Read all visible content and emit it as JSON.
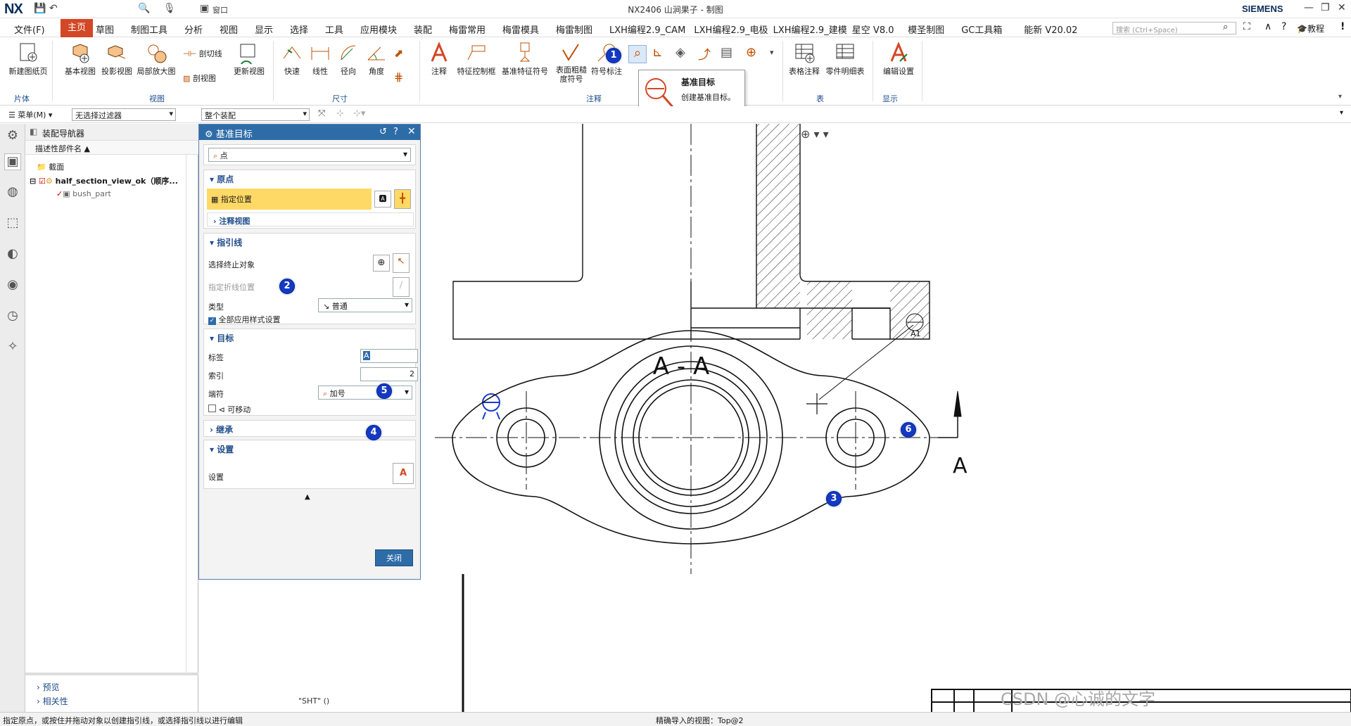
{
  "titlebar": {
    "logo": "NX",
    "title": "NX2406 山涧果子 - 制图",
    "brand": "SIEMENS",
    "quick_access": [
      "save-icon",
      "undo-icon",
      "window-menu"
    ],
    "window_menu_label": "窗口"
  },
  "menubar": {
    "file": "文件(F)",
    "tabs": [
      "主页",
      "草图",
      "制图工具",
      "分析",
      "视图",
      "显示",
      "选择",
      "工具",
      "应用模块",
      "装配",
      "梅雷常用",
      "梅雷模具",
      "梅雷制图",
      "LXH编程2.9_CAM",
      "LXH编程2.9_电极",
      "LXH编程2.9_建模",
      "星空 V8.0",
      "模圣制图",
      "GC工具箱",
      "能新 V20.02"
    ],
    "active_tab": "主页",
    "search_placeholder": "搜索 (Ctrl+Space)",
    "help_label": "教程"
  },
  "ribbon": {
    "groups": [
      "片体",
      "视图",
      "尺寸",
      "注释",
      "表",
      "显示"
    ],
    "buttons": {
      "new_sheet": "新建图纸页",
      "base_view": "基本视图",
      "projected_view": "投影视图",
      "detail_view": "局部放大图",
      "section_line": "剖切线",
      "section_view": "剖视图",
      "update_view": "更新视图",
      "rapid": "快速",
      "linear": "线性",
      "radial": "径向",
      "angle": "角度",
      "note": "注释",
      "fcf": "特征控制框",
      "datum_feature": "基准特征符号",
      "surface_finish": "表面粗糙度符号",
      "symbol_annotation": "符号标注",
      "table_note": "表格注释",
      "parts_list": "零件明细表",
      "edit_settings": "编辑设置"
    }
  },
  "tooltip": {
    "title": "基准目标",
    "description": "创建基准目标。"
  },
  "filterbar": {
    "menu": "菜单(M)",
    "filter": "无选择过滤器",
    "scope": "整个装配"
  },
  "navigator": {
    "title": "装配导航器",
    "column": "描述性部件名",
    "rows": [
      "截面",
      "half_section_view_ok（顺序...",
      "bush_part"
    ],
    "bottom": [
      "预览",
      "相关性"
    ]
  },
  "dialog": {
    "title": "基准目标",
    "type_value": "点",
    "origin": {
      "header": "原点",
      "specify_location": "指定位置",
      "annotation_view": "注释视图"
    },
    "leader": {
      "header": "指引线",
      "select_terminator": "选择终止对象",
      "specify_jog": "指定折线位置",
      "type_label": "类型",
      "type_value": "普通",
      "apply_all": "全部应用样式设置"
    },
    "target": {
      "header": "目标",
      "label_label": "标签",
      "label_value": "A",
      "index_label": "索引",
      "index_value": "2",
      "terminator_label": "端符",
      "terminator_value": "加号",
      "movable": "可移动"
    },
    "inherit": {
      "header": "继承"
    },
    "settings": {
      "header": "设置",
      "label": "设置"
    },
    "close": "关闭"
  },
  "markers": [
    "1",
    "2",
    "3",
    "4",
    "5",
    "6"
  ],
  "drawing": {
    "section_label": "A - A",
    "arrow_label": "A",
    "target_label": "A1",
    "sheet_label": "\"SHT\" ()",
    "watermark": "CSDN @心诚的文字"
  },
  "status": {
    "prompt": "指定原点，或按住并拖动对象以创建指引线，或选择指引线以进行编辑",
    "view": "精确导入的视图：Top@2"
  },
  "colors": {
    "accent": "#d24726",
    "dialog_header": "#2e6ca8",
    "highlight": "#ffd966",
    "marker": "#1339c4"
  }
}
